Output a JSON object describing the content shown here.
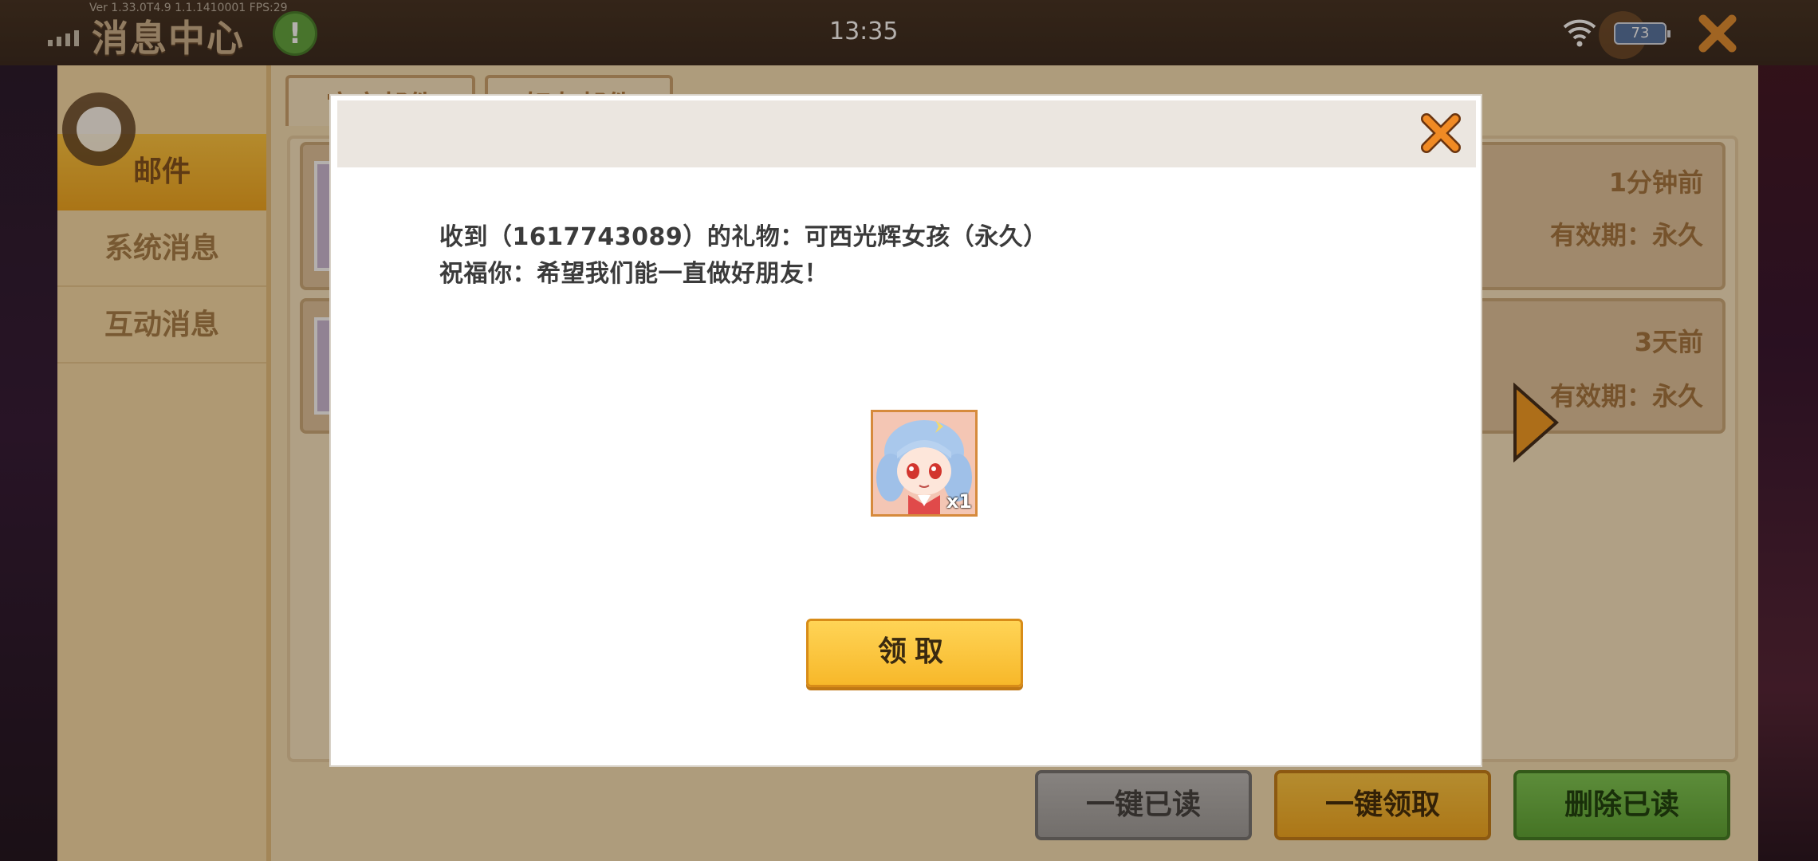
{
  "status_bar": {
    "version_text": "Ver 1.33.0T4.9 1.1.1410001 FPS:29",
    "time": "13:35",
    "battery": "73"
  },
  "header": {
    "title": "消息中心"
  },
  "sidebar": {
    "items": [
      {
        "label": "邮件",
        "active": true
      },
      {
        "label": "系统消息",
        "active": false
      },
      {
        "label": "互动消息",
        "active": false
      }
    ]
  },
  "tabs": [
    {
      "label": "官方邮件"
    },
    {
      "label": "好友邮件"
    }
  ],
  "mail_list": [
    {
      "time": "1分钟前",
      "expiry": "有效期：永久"
    },
    {
      "time": "3天前",
      "expiry": "有效期：永久"
    }
  ],
  "actions": {
    "read_all": "一键已读",
    "claim_all": "一键领取",
    "delete_read": "删除已读"
  },
  "modal": {
    "line1": "收到（1617743089）的礼物：可西光辉女孩（永久）",
    "line2": "祝福你：希望我们能一直做好朋友！",
    "gift_qty": "x1",
    "claim_label": "领取"
  },
  "colors": {
    "accent_yellow": "#f7b82a",
    "close_orange": "#f08a24",
    "green": "#55a32e"
  }
}
